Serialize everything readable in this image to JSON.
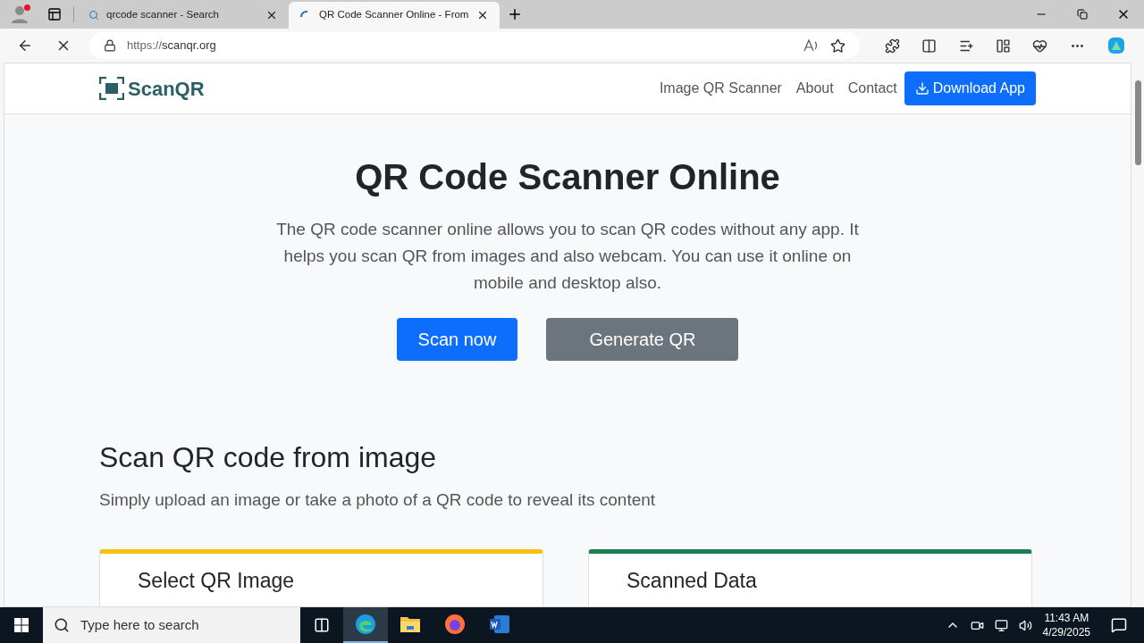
{
  "browser": {
    "tabs": [
      {
        "title": "qrcode scanner - Search",
        "kind": "search",
        "selected": false
      },
      {
        "title": "QR Code Scanner Online - From",
        "kind": "loading",
        "selected": true
      }
    ],
    "address": {
      "scheme": "https://",
      "host": "scanqr.org"
    }
  },
  "site": {
    "logo": "ScanQR",
    "nav": [
      "Image QR Scanner",
      "About",
      "Contact"
    ],
    "download": "Download App",
    "hero": {
      "title": "QR Code Scanner Online",
      "description": "The QR code scanner online allows you to scan QR codes without any app. It helps you scan QR from images and also webcam. You can use it online on mobile and desktop also.",
      "buttons": [
        {
          "label": "Scan now",
          "kind": "primary"
        },
        {
          "label": "Generate QR",
          "kind": "secondary"
        }
      ]
    },
    "section": {
      "title": "Scan QR code from image",
      "subtitle": "Simply upload an image or take a photo of a QR code to reveal its content"
    },
    "cards": [
      {
        "title": "Select QR Image",
        "color": "#f5c211"
      },
      {
        "title": "Scanned Data",
        "color": "#1e7d52"
      }
    ]
  },
  "taskbar": {
    "search": {
      "placeholder": "Type here to search"
    },
    "apps": [
      {
        "kind": "edge",
        "selected": true
      },
      {
        "kind": "folder",
        "selected": false
      },
      {
        "kind": "firefox",
        "selected": false
      },
      {
        "kind": "word",
        "selected": false
      }
    ],
    "time": "11:43 AM",
    "date": "4/29/2025"
  }
}
